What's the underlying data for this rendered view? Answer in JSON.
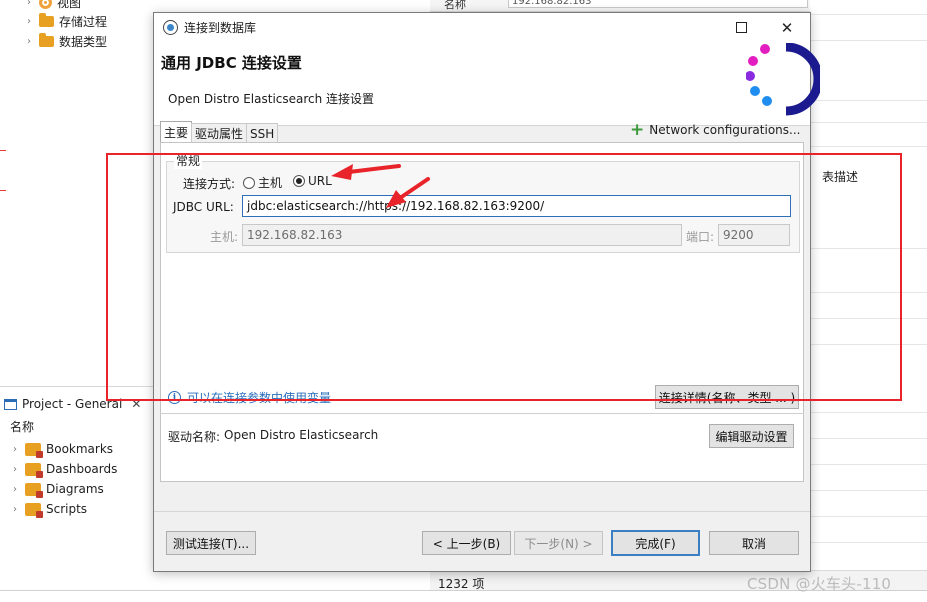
{
  "background": {
    "tree": [
      {
        "label": "视图",
        "icon": "view-icon"
      },
      {
        "label": "存储过程",
        "icon": "folder-icon"
      },
      {
        "label": "数据类型",
        "icon": "folder-icon"
      }
    ],
    "project_panel": {
      "title": "Project - General",
      "column": "名称",
      "items": [
        "Bookmarks",
        "Dashboards",
        "Diagrams",
        "Scripts"
      ]
    },
    "top_label": "名称",
    "top_value": "192.168.82.163",
    "table_desc": "表描述",
    "item_count": "1232 项",
    "watermark": "CSDN @火车头-110"
  },
  "dialog": {
    "window_title": "连接到数据库",
    "heading": "通用 JDBC 连接设置",
    "subheading": "Open Distro Elasticsearch 连接设置",
    "tabs": [
      {
        "label": "主要",
        "active": true
      },
      {
        "label": "驱动属性",
        "active": false
      },
      {
        "label": "SSH",
        "active": false
      }
    ],
    "network_configurations": "Network configurations...",
    "group_title": "常规",
    "connect_mode_label": "连接方式:",
    "radio_host": "主机",
    "radio_url": "URL",
    "selected_mode": "URL",
    "jdbc_url_label": "JDBC URL:",
    "jdbc_url_value": "jdbc:elasticsearch://https://192.168.82.163:9200/",
    "host_label": "主机:",
    "host_value": "192.168.82.163",
    "port_label": "端口:",
    "port_value": "9200",
    "info_text": "可以在连接参数中使用变量",
    "connection_details_button": "连接详情(名称、类型 ... )",
    "driver_label": "驱动名称:",
    "driver_name": "Open Distro Elasticsearch",
    "edit_driver_button": "编辑驱动设置",
    "test_connection_button": "测试连接(T)...",
    "back_button": "< 上一步(B)",
    "next_button": "下一步(N) >",
    "finish_button": "完成(F)",
    "cancel_button": "取消"
  },
  "colors": {
    "accent_blue": "#3a7fc4",
    "annotation_red": "#e8242a",
    "logo_dark": "#1b1a8f",
    "logo_magenta": "#e21ec0",
    "logo_purple": "#8a2be2",
    "logo_blue": "#1f8ef0"
  }
}
